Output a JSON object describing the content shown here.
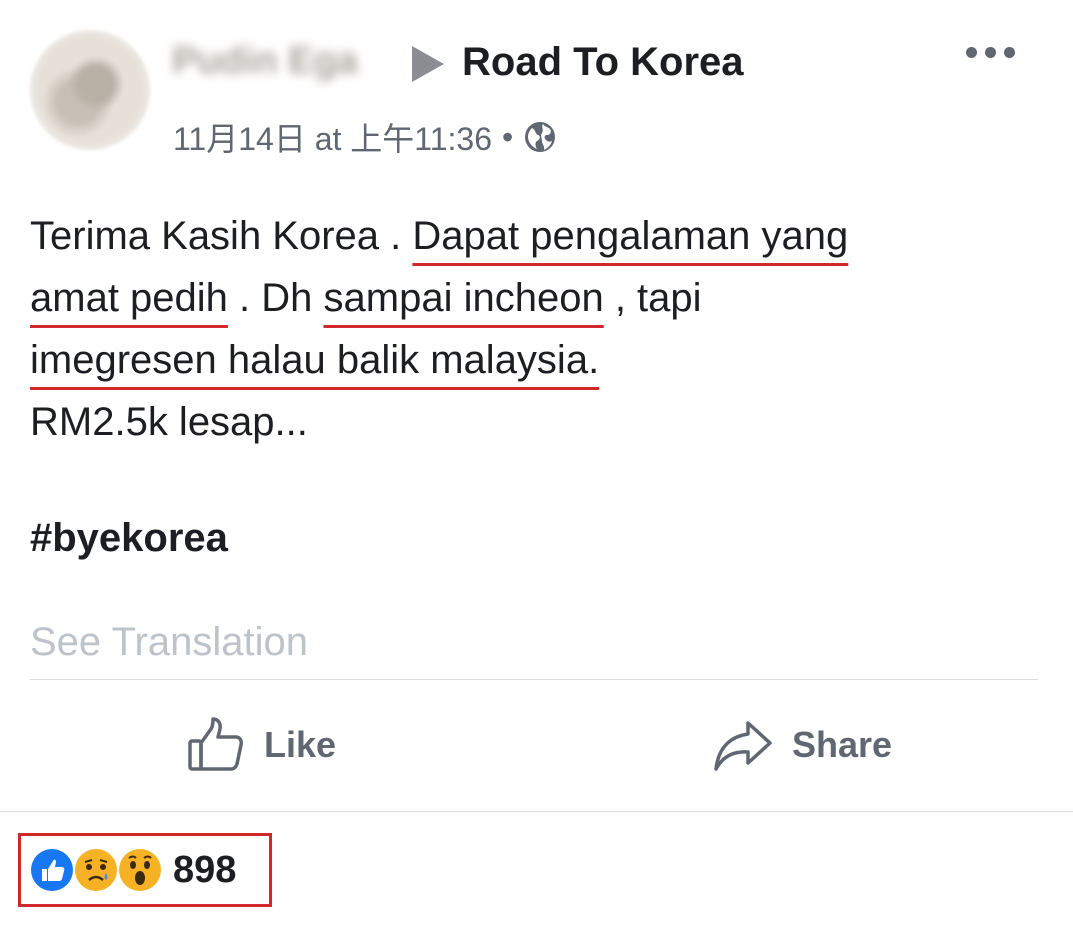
{
  "post": {
    "author_name": "Pudin Ega",
    "group_name": "Road To Korea",
    "timestamp": "11月14日 at 上午11:36",
    "separator": "•",
    "privacy_icon": "globe-icon",
    "text_lines": [
      {
        "segments": [
          {
            "text": "Terima Kasih Korea . ",
            "underline": false
          },
          {
            "text": "Dapat pengalaman yang",
            "underline": true
          }
        ]
      },
      {
        "segments": [
          {
            "text": "amat pedih",
            "underline": true
          },
          {
            "text": " . Dh ",
            "underline": false
          },
          {
            "text": "sampai incheon",
            "underline": true
          },
          {
            "text": " , tapi",
            "underline": false
          }
        ]
      },
      {
        "segments": [
          {
            "text": "imegresen halau balik malaysia.",
            "underline": true
          }
        ]
      },
      {
        "segments": [
          {
            "text": "RM2.5k lesap...",
            "underline": false
          }
        ]
      }
    ],
    "hashtag": "#byekorea",
    "see_translation": "See Translation"
  },
  "actions": {
    "like_label": "Like",
    "share_label": "Share"
  },
  "reactions": {
    "types": [
      "like",
      "sad",
      "wow"
    ],
    "count": "898"
  },
  "colors": {
    "annotation_red": "#d0282b",
    "like_blue": "#1877f2",
    "secondary_text": "#606770"
  }
}
